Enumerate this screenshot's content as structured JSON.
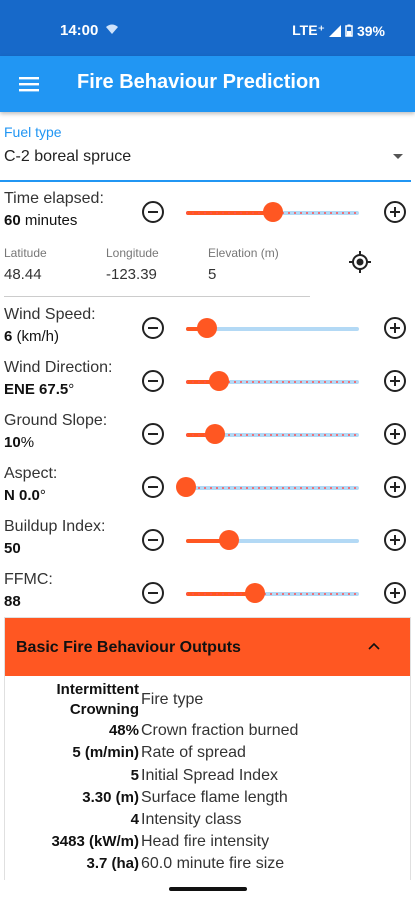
{
  "status_bar": {
    "time": "14:00",
    "network": "LTE⁺",
    "battery": "39%"
  },
  "app_bar": {
    "title": "Fire Behaviour Prediction",
    "menu_icon": "hamburger-menu-icon"
  },
  "fuel": {
    "label": "Fuel type",
    "value": "C-2 boreal spruce"
  },
  "time_elapsed": {
    "name": "Time elapsed:",
    "value": "60",
    "unit": " minutes",
    "fraction": 0.5
  },
  "location": {
    "latitude_label": "Latitude",
    "latitude": "48.44",
    "longitude_label": "Longitude",
    "longitude": "-123.39",
    "elevation_label": "Elevation (m)",
    "elevation": "5",
    "locate_icon": "my-location-icon"
  },
  "wind_speed": {
    "name": "Wind Speed:",
    "value": "6",
    "unit": " (km/h)",
    "fraction": 0.12
  },
  "wind_direction": {
    "name": "Wind Direction:",
    "value": "ENE 67.5",
    "unit": "°",
    "fraction": 0.19
  },
  "ground_slope": {
    "name": "Ground Slope:",
    "value": "10",
    "unit": "%",
    "fraction": 0.17
  },
  "aspect": {
    "name": "Aspect:",
    "value": "N 0.0",
    "unit": "°",
    "fraction": 0.0
  },
  "buildup_index": {
    "name": "Buildup Index:",
    "value": "50",
    "unit": "",
    "fraction": 0.25
  },
  "ffmc": {
    "name": "FFMC:",
    "value": "88",
    "unit": "",
    "fraction": 0.4
  },
  "outputs": {
    "title": "Basic Fire Behaviour Outputs",
    "rows": [
      {
        "value": "Intermittent Crowning",
        "label": "Fire type"
      },
      {
        "value": "48%",
        "label": "Crown fraction burned"
      },
      {
        "value": "5 (m/min)",
        "label": "Rate of spread"
      },
      {
        "value": "5",
        "label": "Initial Spread Index"
      },
      {
        "value": "3.30 (m)",
        "label": "Surface flame length"
      },
      {
        "value": "4",
        "label": "Intensity class"
      },
      {
        "value": "3483 (kW/m)",
        "label": "Head fire intensity"
      },
      {
        "value": "3.7 (ha)",
        "label": "60.0 minute fire size"
      }
    ]
  },
  "colors": {
    "status_bar": "#1769c9",
    "app_bar": "#2196f3",
    "accent": "#ff5722",
    "track": "#b3d9f5"
  }
}
